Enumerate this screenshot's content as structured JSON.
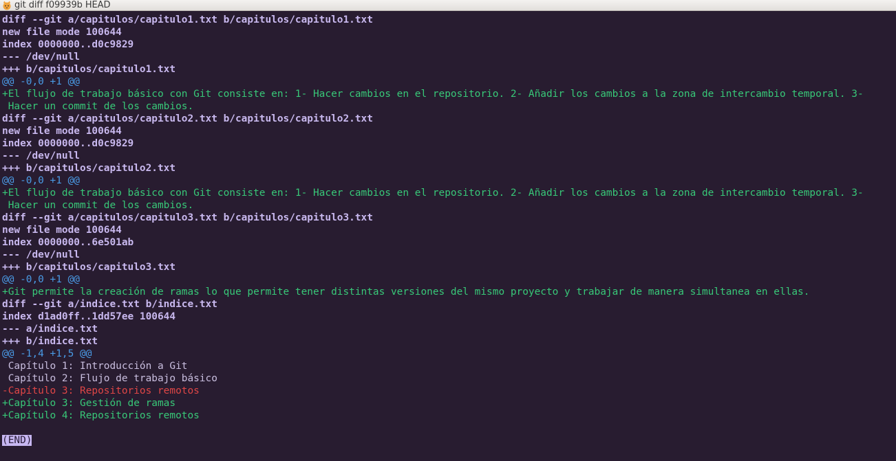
{
  "window": {
    "title": "git diff f09939b HEAD",
    "icon": "terminal-cat-icon"
  },
  "colors": {
    "background": "#281c30",
    "meta": "#c8b8ee",
    "hunk": "#4a9be6",
    "added": "#38c878",
    "removed": "#e04646",
    "context": "#c9bedf"
  },
  "lines": [
    {
      "type": "meta",
      "text": "diff --git a/capitulos/capitulo1.txt b/capitulos/capitulo1.txt"
    },
    {
      "type": "meta",
      "text": "new file mode 100644"
    },
    {
      "type": "meta",
      "text": "index 0000000..d0c9829"
    },
    {
      "type": "meta",
      "text": "--- /dev/null"
    },
    {
      "type": "meta",
      "text": "+++ b/capitulos/capitulo1.txt"
    },
    {
      "type": "hunk",
      "text": "@@ -0,0 +1 @@"
    },
    {
      "type": "add",
      "text": "+El flujo de trabajo básico con Git consiste en: 1- Hacer cambios en el repositorio. 2- Añadir los cambios a la zona de intercambio temporal. 3-"
    },
    {
      "type": "add",
      "text": " Hacer un commit de los cambios."
    },
    {
      "type": "meta",
      "text": "diff --git a/capitulos/capitulo2.txt b/capitulos/capitulo2.txt"
    },
    {
      "type": "meta",
      "text": "new file mode 100644"
    },
    {
      "type": "meta",
      "text": "index 0000000..d0c9829"
    },
    {
      "type": "meta",
      "text": "--- /dev/null"
    },
    {
      "type": "meta",
      "text": "+++ b/capitulos/capitulo2.txt"
    },
    {
      "type": "hunk",
      "text": "@@ -0,0 +1 @@"
    },
    {
      "type": "add",
      "text": "+El flujo de trabajo básico con Git consiste en: 1- Hacer cambios en el repositorio. 2- Añadir los cambios a la zona de intercambio temporal. 3-"
    },
    {
      "type": "add",
      "text": " Hacer un commit de los cambios."
    },
    {
      "type": "meta",
      "text": "diff --git a/capitulos/capitulo3.txt b/capitulos/capitulo3.txt"
    },
    {
      "type": "meta",
      "text": "new file mode 100644"
    },
    {
      "type": "meta",
      "text": "index 0000000..6e501ab"
    },
    {
      "type": "meta",
      "text": "--- /dev/null"
    },
    {
      "type": "meta",
      "text": "+++ b/capitulos/capitulo3.txt"
    },
    {
      "type": "hunk",
      "text": "@@ -0,0 +1 @@"
    },
    {
      "type": "add",
      "text": "+Git permite la creación de ramas lo que permite tener distintas versiones del mismo proyecto y trabajar de manera simultanea en ellas."
    },
    {
      "type": "meta",
      "text": "diff --git a/indice.txt b/indice.txt"
    },
    {
      "type": "meta",
      "text": "index d1ad0ff..1dd57ee 100644"
    },
    {
      "type": "meta",
      "text": "--- a/indice.txt"
    },
    {
      "type": "meta",
      "text": "+++ b/indice.txt"
    },
    {
      "type": "hunk",
      "text": "@@ -1,4 +1,5 @@"
    },
    {
      "type": "ctx",
      "text": " Capítulo 1: Introducción a Git"
    },
    {
      "type": "ctx",
      "text": " Capítulo 2: Flujo de trabajo básico"
    },
    {
      "type": "del",
      "text": "-Capítulo 3: Repositorios remotos"
    },
    {
      "type": "add",
      "text": "+Capítulo 3: Gestión de ramas"
    },
    {
      "type": "add",
      "text": "+Capítulo 4: Repositorios remotos"
    },
    {
      "type": "blank",
      "text": ""
    }
  ],
  "pager": {
    "end_label": "(END)"
  }
}
